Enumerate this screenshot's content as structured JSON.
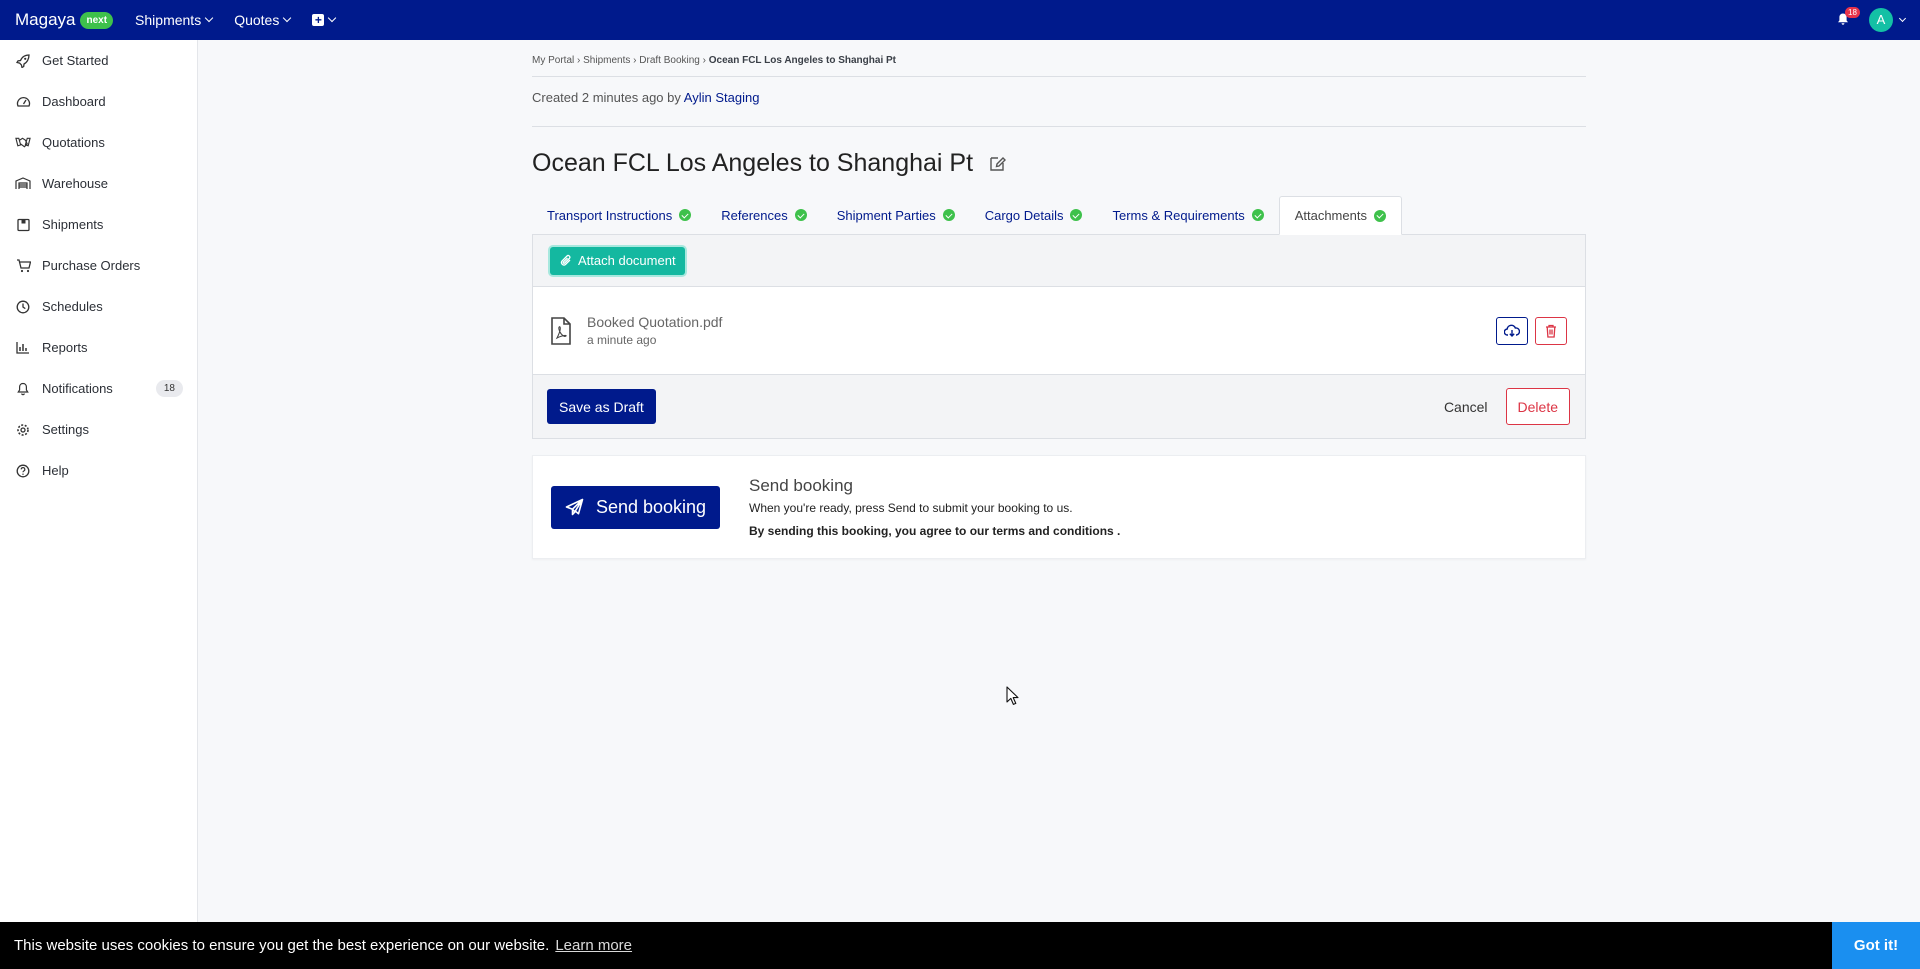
{
  "topbar": {
    "brand": "Magaya",
    "brand_badge": "next",
    "nav": [
      {
        "label": "Shipments"
      },
      {
        "label": "Quotes"
      }
    ],
    "notification_count": "18",
    "avatar_initial": "A"
  },
  "sidebar": {
    "items": [
      {
        "label": "Get Started",
        "icon": "rocket-icon"
      },
      {
        "label": "Dashboard",
        "icon": "gauge-icon"
      },
      {
        "label": "Quotations",
        "icon": "handshake-icon"
      },
      {
        "label": "Warehouse",
        "icon": "warehouse-icon"
      },
      {
        "label": "Shipments",
        "icon": "box-icon"
      },
      {
        "label": "Purchase Orders",
        "icon": "cart-icon"
      },
      {
        "label": "Schedules",
        "icon": "clock-icon"
      },
      {
        "label": "Reports",
        "icon": "bar-chart-icon"
      },
      {
        "label": "Notifications",
        "icon": "bell-icon",
        "badge": "18"
      },
      {
        "label": "Settings",
        "icon": "gear-icon"
      },
      {
        "label": "Help",
        "icon": "help-icon"
      }
    ]
  },
  "breadcrumb": {
    "items": [
      "My Portal",
      "Shipments",
      "Draft Booking"
    ],
    "current": "Ocean FCL Los Angeles to Shanghai Pt"
  },
  "created": {
    "prefix": "Created 2 minutes ago by",
    "author": "Aylin Staging"
  },
  "page_title": "Ocean FCL Los Angeles to Shanghai Pt",
  "tabs": [
    {
      "label": "Transport Instructions",
      "complete": true
    },
    {
      "label": "References",
      "complete": true
    },
    {
      "label": "Shipment Parties",
      "complete": true
    },
    {
      "label": "Cargo Details",
      "complete": true
    },
    {
      "label": "Terms & Requirements",
      "complete": true
    },
    {
      "label": "Attachments",
      "complete": true,
      "active": true
    }
  ],
  "attachments": {
    "attach_label": "Attach document",
    "files": [
      {
        "name": "Booked Quotation.pdf",
        "time": "a minute ago"
      }
    ]
  },
  "actions": {
    "save_draft": "Save as Draft",
    "cancel": "Cancel",
    "delete": "Delete"
  },
  "send": {
    "button": "Send booking",
    "heading": "Send booking",
    "description": "When you're ready, press Send to submit your booking to us.",
    "terms": "By sending this booking, you agree to our terms and conditions ."
  },
  "cookie": {
    "message": "This website uses cookies to ensure you get the best experience on our website.",
    "link": "Learn more",
    "button": "Got it!"
  },
  "colors": {
    "primary": "#001a8c",
    "accent": "#14b8a0",
    "success": "#3ec14b",
    "danger": "#dc3545",
    "cookie_button": "#1a8ff0"
  }
}
